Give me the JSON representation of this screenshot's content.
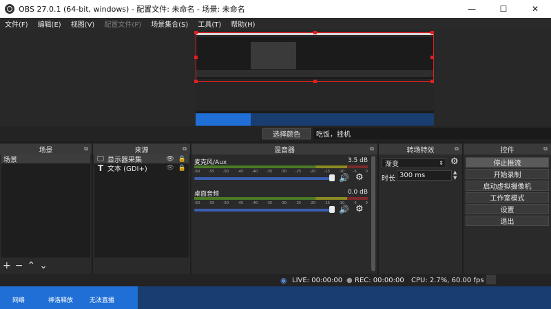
{
  "window": {
    "title": "OBS 27.0.1 (64-bit, windows) - 配置文件: 未命名 - 场景: 未命名",
    "minimize": "—",
    "maximize": "☐",
    "close": "✕"
  },
  "menu": [
    {
      "label": "文件(F)",
      "disabled": false
    },
    {
      "label": "编辑(E)",
      "disabled": false
    },
    {
      "label": "视图(V)",
      "disabled": false
    },
    {
      "label": "配置文件(P)",
      "disabled": true
    },
    {
      "label": "场景集合(S)",
      "disabled": false
    },
    {
      "label": "工具(T)",
      "disabled": false
    },
    {
      "label": "帮助(H)",
      "disabled": false
    }
  ],
  "text_source": {
    "pick_color_label": "选择颜色",
    "text_value": "吃饭，挂机"
  },
  "scenes": {
    "header": "场景",
    "items": [
      "场景"
    ]
  },
  "sources": {
    "header": "来源",
    "items": [
      {
        "name": "显示器采集",
        "icon": "monitor-icon",
        "visible": true,
        "locked": true
      },
      {
        "name": "文本 (GDI+)",
        "icon": "text-icon",
        "visible": false,
        "locked": true
      }
    ]
  },
  "mixer": {
    "header": "混音器",
    "channels": [
      {
        "name": "麦克风/Aux",
        "db": "3.5 dB"
      },
      {
        "name": "桌面音频",
        "db": "0.0 dB"
      }
    ],
    "ticks": [
      "-60",
      "-55",
      "-50",
      "-45",
      "-40",
      "-35",
      "-30",
      "-25",
      "-20",
      "-15",
      "-10",
      "-5",
      "0"
    ]
  },
  "transitions": {
    "header": "转场特效",
    "selected": "渐变",
    "duration_label": "时长",
    "duration_value": "300 ms"
  },
  "controls": {
    "header": "控件",
    "buttons": [
      "停止推流",
      "开始录制",
      "启动虚拟摄像机",
      "工作室模式",
      "设置",
      "退出"
    ]
  },
  "status": {
    "live": "LIVE: 00:00:00",
    "rec": "REC: 00:00:00",
    "cpu": "CPU: 2.7%, 60.00 fps"
  },
  "taskbar": {
    "items": [
      "网络",
      "神洛释放",
      "无法直播"
    ]
  }
}
